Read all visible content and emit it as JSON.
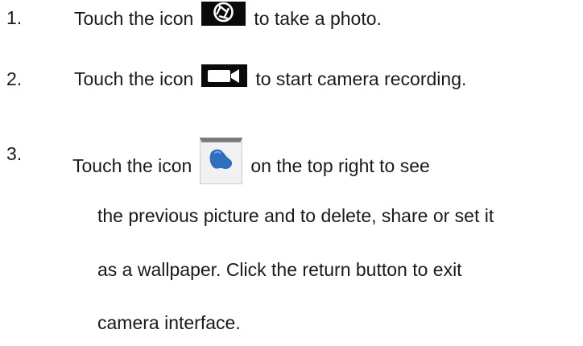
{
  "steps": [
    {
      "number": "1.",
      "before_icon": "Touch the icon",
      "icon": "camera-shutter-icon",
      "after_icon": "to take a photo."
    },
    {
      "number": "2.",
      "before_icon": "Touch the icon",
      "icon": "video-camera-icon",
      "after_icon": "to start camera recording."
    },
    {
      "number": "3.",
      "before_icon": "Touch the icon",
      "icon": "gallery-thumbnail-icon",
      "after_icon": "on the top right to see",
      "continuation": [
        "the previous picture and to delete, share or set it",
        "as a wallpaper. Click the return button to exit",
        "camera interface."
      ]
    }
  ],
  "colors": {
    "text": "#1a1a1a",
    "icon_dark": "#0a0a0a",
    "gallery_blue": "#2f6fc0"
  }
}
